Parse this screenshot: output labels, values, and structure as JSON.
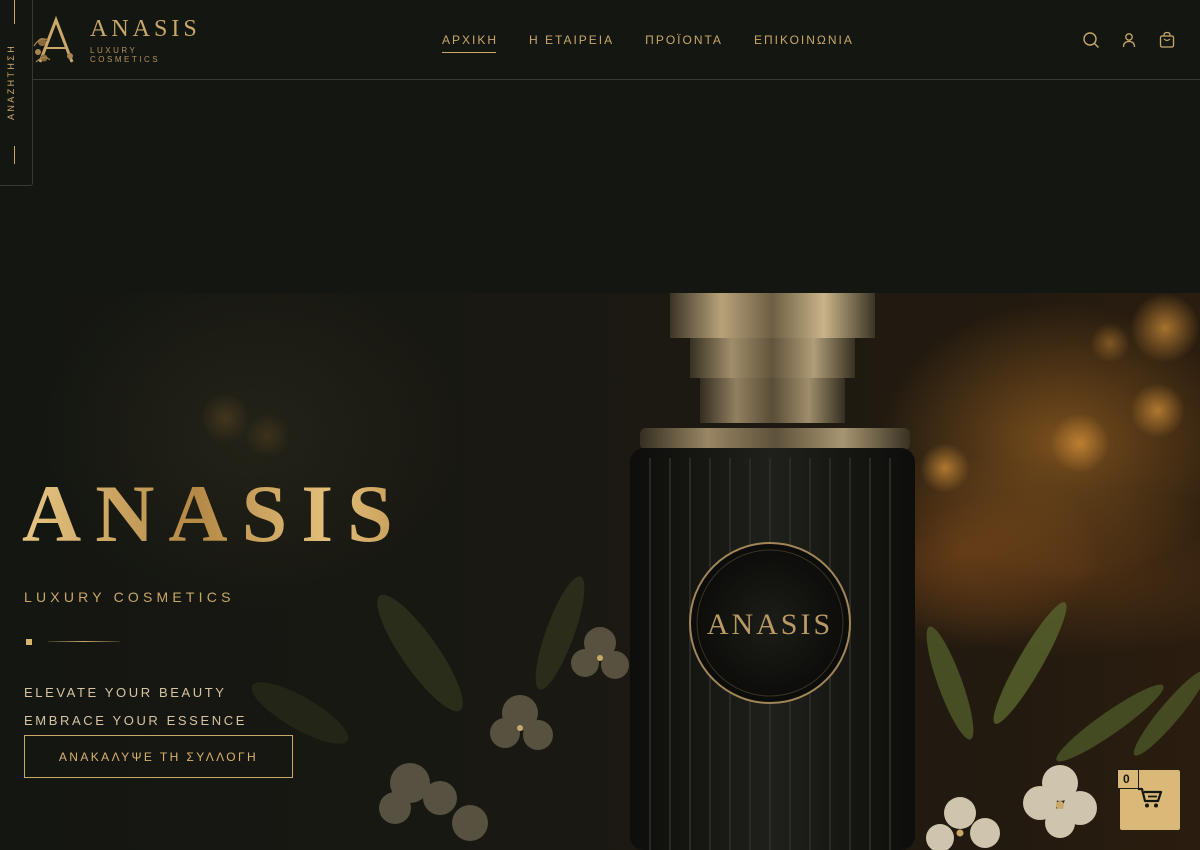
{
  "brand": {
    "name": "ANASIS",
    "subtitle": "LUXURY COSMETICS"
  },
  "nav": {
    "items": [
      {
        "label": "ΑΡΧΙΚΗ",
        "active": true
      },
      {
        "label": "Η ΕΤΑΙΡΕΙΑ",
        "active": false
      },
      {
        "label": "ΠΡΟΪΟΝΤΑ",
        "active": false
      },
      {
        "label": "ΕΠΙΚΟΙΝΩΝΙΑ",
        "active": false
      }
    ]
  },
  "header_icons": [
    "search-icon",
    "user-icon",
    "bag-icon"
  ],
  "side_search": {
    "label": "ΑΝΑΖΗΤΗΣΗ"
  },
  "hero": {
    "title": "ANASIS",
    "subtitle": "LUXURY COSMETICS",
    "tagline_1": "ELEVATE YOUR BEAUTY",
    "tagline_2": "EMBRACE YOUR ESSENCE",
    "cta_label": "ΑΝΑΚΑΛΥΨΕ ΤΗ ΣΥΛΛΟΓΗ",
    "bottle_label": "ANASIS"
  },
  "floating_cart": {
    "count": "0"
  },
  "colors": {
    "background": "#141611",
    "gold": "#c9a86a",
    "cart_bg": "#d9b878"
  }
}
